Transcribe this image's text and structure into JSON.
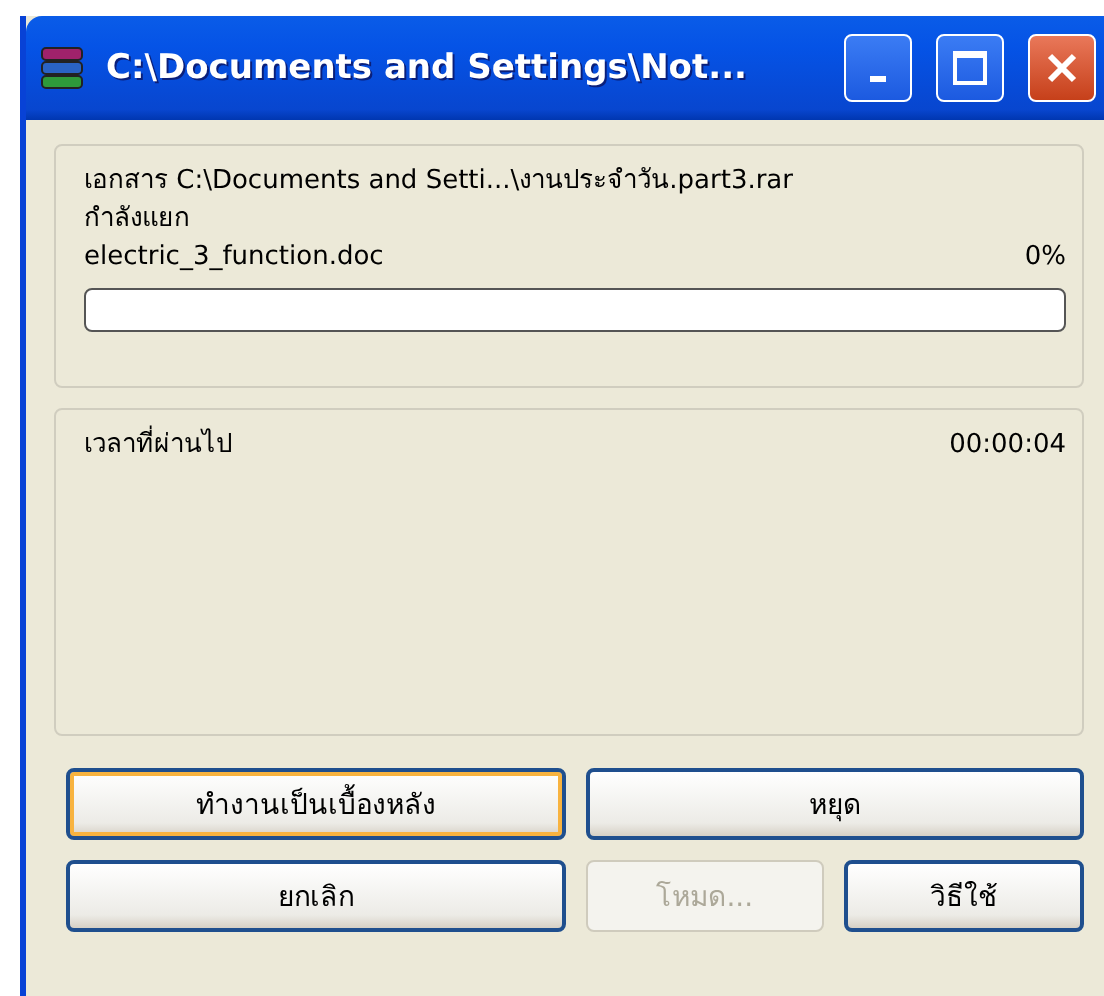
{
  "window": {
    "title": "C:\\Documents and Settings\\Not..."
  },
  "progress": {
    "archive": "เอกสาร C:\\Documents and Setti...\\งานประจำวัน.part3.rar",
    "action": "กำลังแยก",
    "file": "electric_3_function.doc",
    "percent": "0%",
    "level": 0
  },
  "time": {
    "label": "เวลาที่ผ่านไป",
    "value": "00:00:04"
  },
  "buttons": [
    {
      "label": "ทำงานเป็นเบื้องหลัง",
      "focused": true,
      "disabled": false,
      "kind": "wide"
    },
    {
      "label": "หยุด",
      "focused": false,
      "disabled": false,
      "kind": "wide"
    },
    {
      "label": "ยกเลิก",
      "focused": false,
      "disabled": false,
      "kind": "wide"
    },
    {
      "label": "โหมด...",
      "focused": false,
      "disabled": true,
      "kind": "narrow"
    },
    {
      "label": "วิธีใช้",
      "focused": false,
      "disabled": false,
      "kind": "narrow"
    }
  ]
}
